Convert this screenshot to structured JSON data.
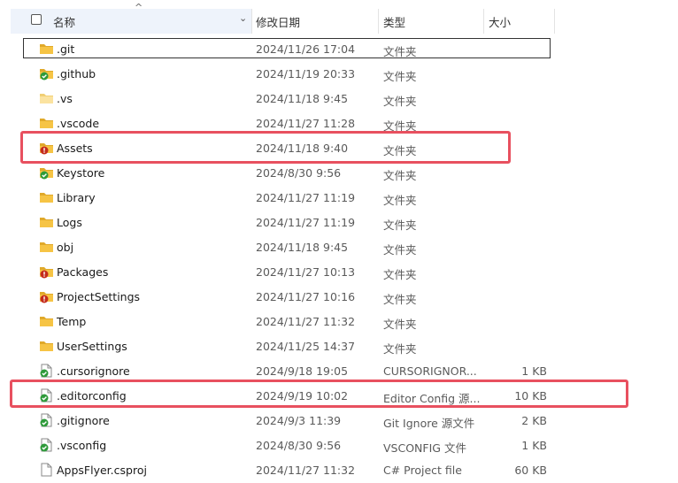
{
  "header": {
    "name": "名称",
    "date": "修改日期",
    "type": "类型",
    "size": "大小",
    "sort_icon": "sort-up-caret",
    "dropdown_icon": "chevron-down"
  },
  "files": [
    {
      "name": ".git",
      "date": "2024/11/26 17:04",
      "type": "文件夹",
      "size": "",
      "icon": "folder",
      "status": "none"
    },
    {
      "name": ".github",
      "date": "2024/11/19 20:33",
      "type": "文件夹",
      "size": "",
      "icon": "folder",
      "status": "synced"
    },
    {
      "name": ".vs",
      "date": "2024/11/18 9:45",
      "type": "文件夹",
      "size": "",
      "icon": "folder-light",
      "status": "none"
    },
    {
      "name": ".vscode",
      "date": "2024/11/27 11:28",
      "type": "文件夹",
      "size": "",
      "icon": "folder",
      "status": "none"
    },
    {
      "name": "Assets",
      "date": "2024/11/18 9:40",
      "type": "文件夹",
      "size": "",
      "icon": "folder",
      "status": "error"
    },
    {
      "name": "Keystore",
      "date": "2024/8/30 9:56",
      "type": "文件夹",
      "size": "",
      "icon": "folder",
      "status": "synced"
    },
    {
      "name": "Library",
      "date": "2024/11/27 11:19",
      "type": "文件夹",
      "size": "",
      "icon": "folder",
      "status": "none"
    },
    {
      "name": "Logs",
      "date": "2024/11/27 11:19",
      "type": "文件夹",
      "size": "",
      "icon": "folder",
      "status": "none"
    },
    {
      "name": "obj",
      "date": "2024/11/18 9:45",
      "type": "文件夹",
      "size": "",
      "icon": "folder",
      "status": "none"
    },
    {
      "name": "Packages",
      "date": "2024/11/27 10:13",
      "type": "文件夹",
      "size": "",
      "icon": "folder",
      "status": "error"
    },
    {
      "name": "ProjectSettings",
      "date": "2024/11/27 10:16",
      "type": "文件夹",
      "size": "",
      "icon": "folder",
      "status": "error"
    },
    {
      "name": "Temp",
      "date": "2024/11/27 11:32",
      "type": "文件夹",
      "size": "",
      "icon": "folder",
      "status": "none"
    },
    {
      "name": "UserSettings",
      "date": "2024/11/25 14:37",
      "type": "文件夹",
      "size": "",
      "icon": "folder",
      "status": "none"
    },
    {
      "name": ".cursorignore",
      "date": "2024/9/18 19:05",
      "type": "CURSORIGNOR...",
      "size": "1 KB",
      "icon": "file",
      "status": "synced"
    },
    {
      "name": ".editorconfig",
      "date": "2024/9/19 10:02",
      "type": "Editor Config 源...",
      "size": "10 KB",
      "icon": "file",
      "status": "synced"
    },
    {
      "name": ".gitignore",
      "date": "2024/9/3 11:39",
      "type": "Git Ignore 源文件",
      "size": "2 KB",
      "icon": "file",
      "status": "synced"
    },
    {
      "name": ".vsconfig",
      "date": "2024/8/30 9:56",
      "type": "VSCONFIG 文件",
      "size": "1 KB",
      "icon": "file",
      "status": "synced"
    },
    {
      "name": "AppsFlyer.csproj",
      "date": "2024/11/27 11:32",
      "type": "C# Project file",
      "size": "60 KB",
      "icon": "file",
      "status": "none"
    }
  ],
  "colors": {
    "folder": "#f6c445",
    "folder_dark": "#e0a92a",
    "synced": "#2e9a3a",
    "error": "#c42b1c",
    "highlight": "#e8505f"
  }
}
